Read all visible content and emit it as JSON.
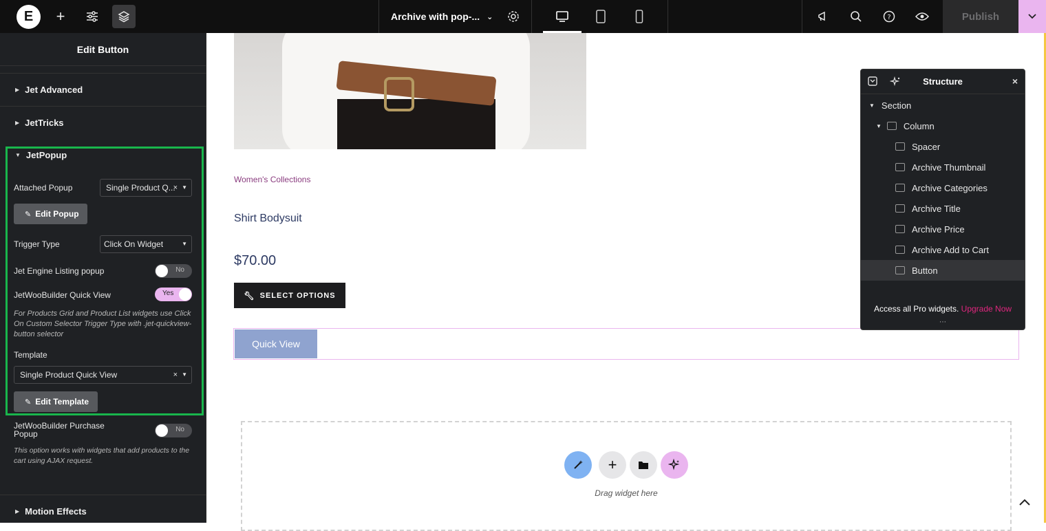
{
  "topbar": {
    "logo_letter": "E",
    "doc_title": "Archive with pop-...",
    "publish_label": "Publish"
  },
  "panel": {
    "title": "Edit Button",
    "sections": {
      "jet_advanced": "Jet Advanced",
      "jettricks": "JetTricks",
      "jetpopup": "JetPopup",
      "motion_effects": "Motion Effects"
    },
    "attached_popup_label": "Attached Popup",
    "attached_popup_value": "Single Product Q...",
    "edit_popup_label": "Edit Popup",
    "trigger_type_label": "Trigger Type",
    "trigger_type_value": "Click On Widget",
    "jet_engine_label": "Jet Engine Listing popup",
    "jet_engine_toggle": "No",
    "quick_view_label": "JetWooBuilder Quick View",
    "quick_view_toggle": "Yes",
    "quick_view_note": "For Products Grid and Product List widgets use Click On Custom Selector Trigger Type with .jet-quickview-button selector",
    "template_label": "Template",
    "template_value": "Single Product Quick View",
    "edit_template_label": "Edit Template",
    "purchase_popup_label": "JetWooBuilder Purchase Popup",
    "purchase_popup_toggle": "No",
    "purchase_note": "This option works with widgets that add products to the cart using AJAX request."
  },
  "canvas": {
    "category": "Women's Collections",
    "product_title": "Shirt Bodysuit",
    "price": "$70.00",
    "select_options": "SELECT OPTIONS",
    "quick_view": "Quick View",
    "drag_text": "Drag widget here"
  },
  "structure": {
    "title": "Structure",
    "items": [
      "Section",
      "Column",
      "Spacer",
      "Archive Thumbnail",
      "Archive Categories",
      "Archive Title",
      "Archive Price",
      "Archive Add to Cart",
      "Button"
    ],
    "upgrade_text": "Access all Pro widgets.",
    "upgrade_link": "Upgrade Now"
  },
  "colors": {
    "accent_pink": "#eab5ef",
    "highlight_green": "#19b64c",
    "upgrade_link": "#e0267e"
  }
}
